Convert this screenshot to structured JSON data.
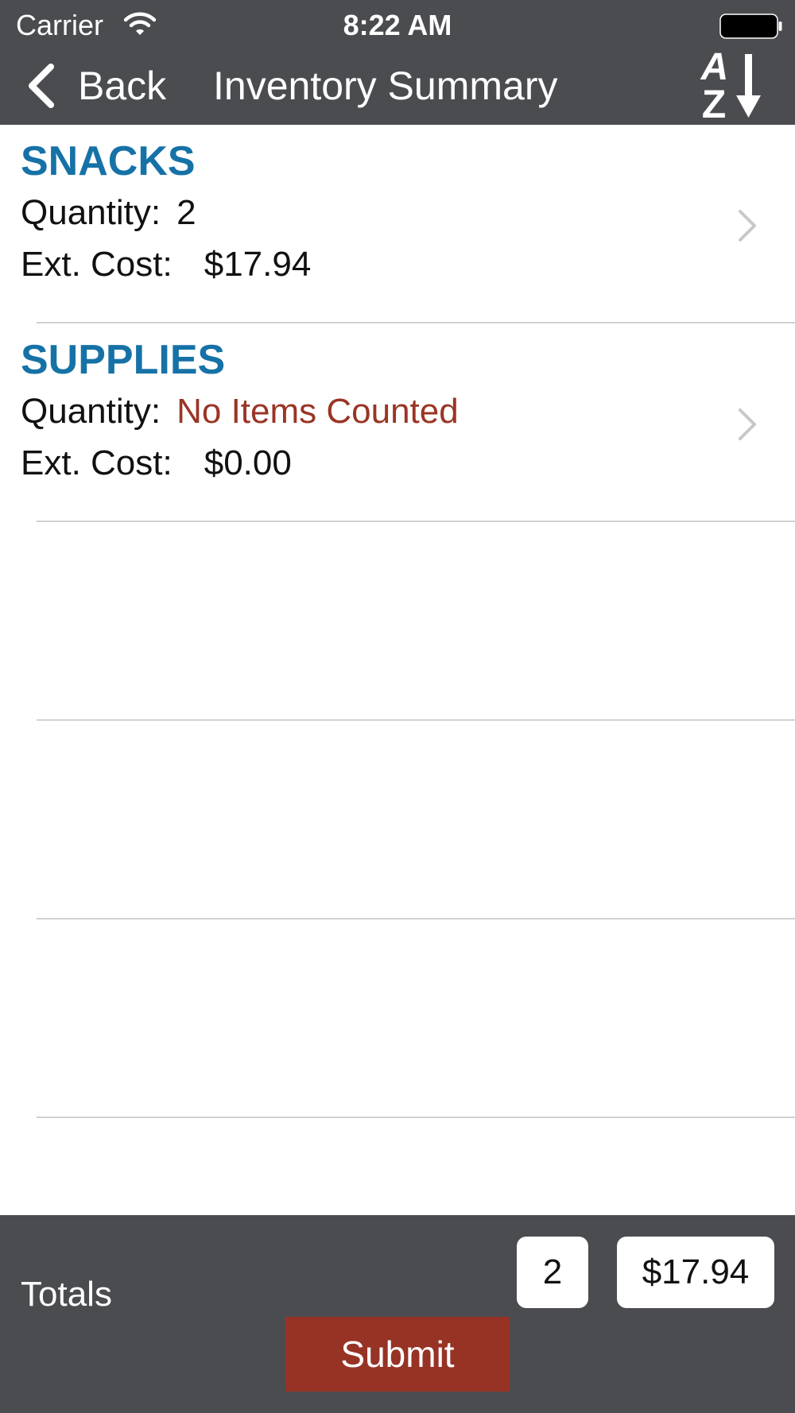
{
  "status_bar": {
    "carrier": "Carrier",
    "time": "8:22 AM"
  },
  "nav": {
    "back_label": "Back",
    "title": "Inventory Summary",
    "sort_icon": "sort-alpha-az-icon",
    "sort_letters": [
      "A",
      "Z"
    ]
  },
  "categories": [
    {
      "name": "SNACKS",
      "quantity_label": "Quantity:",
      "quantity_value": "2",
      "cost_label": "Ext. Cost:",
      "cost_value": "$17.94"
    },
    {
      "name": "SUPPLIES",
      "quantity_label": "Quantity:",
      "quantity_value": "No Items Counted",
      "cost_label": "Ext. Cost:",
      "cost_value": "$0.00"
    }
  ],
  "footer": {
    "totals_label": "Totals",
    "total_quantity": "2",
    "total_cost": "$17.94",
    "submit_label": "Submit"
  },
  "colors": {
    "bar_background": "#4b4c50",
    "category_blue": "#1672a6",
    "empty_red": "#9a3526",
    "submit_red": "#973325"
  }
}
